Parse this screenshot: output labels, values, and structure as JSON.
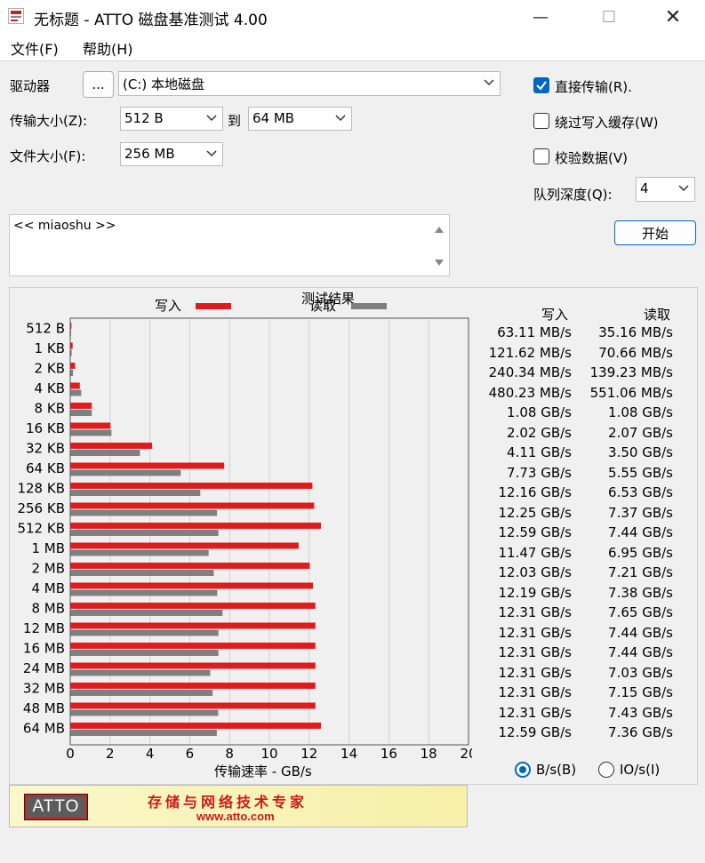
{
  "window": {
    "title": "无标题 - ATTO 磁盘基准测试 4.00",
    "minimize": "—",
    "maximize": "☐",
    "close": "✕"
  },
  "menu": {
    "file": "文件(F)",
    "help": "帮助(H)"
  },
  "form": {
    "drive_label": "驱动器",
    "browse_label": "...",
    "drive_value": "(C:) 本地磁盘",
    "transfer_size_label": "传输大小(Z):",
    "transfer_from": "512 B",
    "to_label": "到",
    "transfer_to": "64 MB",
    "file_size_label": "文件大小(F):",
    "file_size": "256 MB",
    "direct_io_label": "直接传输(R).",
    "bypass_cache_label": "绕过写入缓存(W)",
    "verify_label": "校验数据(V)",
    "queue_depth_label": "队列深度(Q):",
    "queue_depth": "4",
    "start_label": "开始",
    "description": "<< miaoshu >>",
    "direct_io_checked": true,
    "bypass_cache_checked": false,
    "verify_checked": false
  },
  "results": {
    "title": "测试结果",
    "write_header": "写入",
    "read_header": "读取",
    "write_values": [
      "63.11 MB/s",
      "121.62 MB/s",
      "240.34 MB/s",
      "480.23 MB/s",
      "1.08 GB/s",
      "2.02 GB/s",
      "4.11 GB/s",
      "7.73 GB/s",
      "12.16 GB/s",
      "12.25 GB/s",
      "12.59 GB/s",
      "11.47 GB/s",
      "12.03 GB/s",
      "12.19 GB/s",
      "12.31 GB/s",
      "12.31 GB/s",
      "12.31 GB/s",
      "12.31 GB/s",
      "12.31 GB/s",
      "12.31 GB/s",
      "12.59 GB/s"
    ],
    "read_values": [
      "35.16 MB/s",
      "70.66 MB/s",
      "139.23 MB/s",
      "551.06 MB/s",
      "1.08 GB/s",
      "2.07 GB/s",
      "3.50 GB/s",
      "5.55 GB/s",
      "6.53 GB/s",
      "7.37 GB/s",
      "7.44 GB/s",
      "6.95 GB/s",
      "7.21 GB/s",
      "7.38 GB/s",
      "7.65 GB/s",
      "7.44 GB/s",
      "7.44 GB/s",
      "7.03 GB/s",
      "7.15 GB/s",
      "7.43 GB/s",
      "7.36 GB/s"
    ]
  },
  "units": {
    "bytes": "B/s(B)",
    "io": "IO/s(I)",
    "selected": "bytes"
  },
  "banner": {
    "logo": "ATTO",
    "slogan": "存储与网络技术专家",
    "url": "www.atto.com"
  },
  "colors": {
    "write": "#e01b1b",
    "read": "#7f7f7f",
    "accent": "#0067c0"
  },
  "chart_data": {
    "type": "bar",
    "orientation": "horizontal",
    "title": "测试结果",
    "xlabel": "传输速率 - GB/s",
    "xlim": [
      0,
      20
    ],
    "xticks": [
      0,
      2,
      4,
      6,
      8,
      10,
      12,
      14,
      16,
      18,
      20
    ],
    "grid": true,
    "legend": "top",
    "categories": [
      "512 B",
      "1 KB",
      "2 KB",
      "4 KB",
      "8 KB",
      "16 KB",
      "32 KB",
      "64 KB",
      "128 KB",
      "256 KB",
      "512 KB",
      "1 MB",
      "2 MB",
      "4 MB",
      "8 MB",
      "12 MB",
      "16 MB",
      "24 MB",
      "32 MB",
      "48 MB",
      "64 MB"
    ],
    "series": [
      {
        "name": "写入",
        "color": "#e01b1b",
        "values": [
          0.06311,
          0.12162,
          0.24034,
          0.48023,
          1.08,
          2.02,
          4.11,
          7.73,
          12.16,
          12.25,
          12.59,
          11.47,
          12.03,
          12.19,
          12.31,
          12.31,
          12.31,
          12.31,
          12.31,
          12.31,
          12.59
        ]
      },
      {
        "name": "读取",
        "color": "#7f7f7f",
        "values": [
          0.03516,
          0.07066,
          0.13923,
          0.55106,
          1.08,
          2.07,
          3.5,
          5.55,
          6.53,
          7.37,
          7.44,
          6.95,
          7.21,
          7.38,
          7.65,
          7.44,
          7.44,
          7.03,
          7.15,
          7.43,
          7.36
        ]
      }
    ]
  }
}
